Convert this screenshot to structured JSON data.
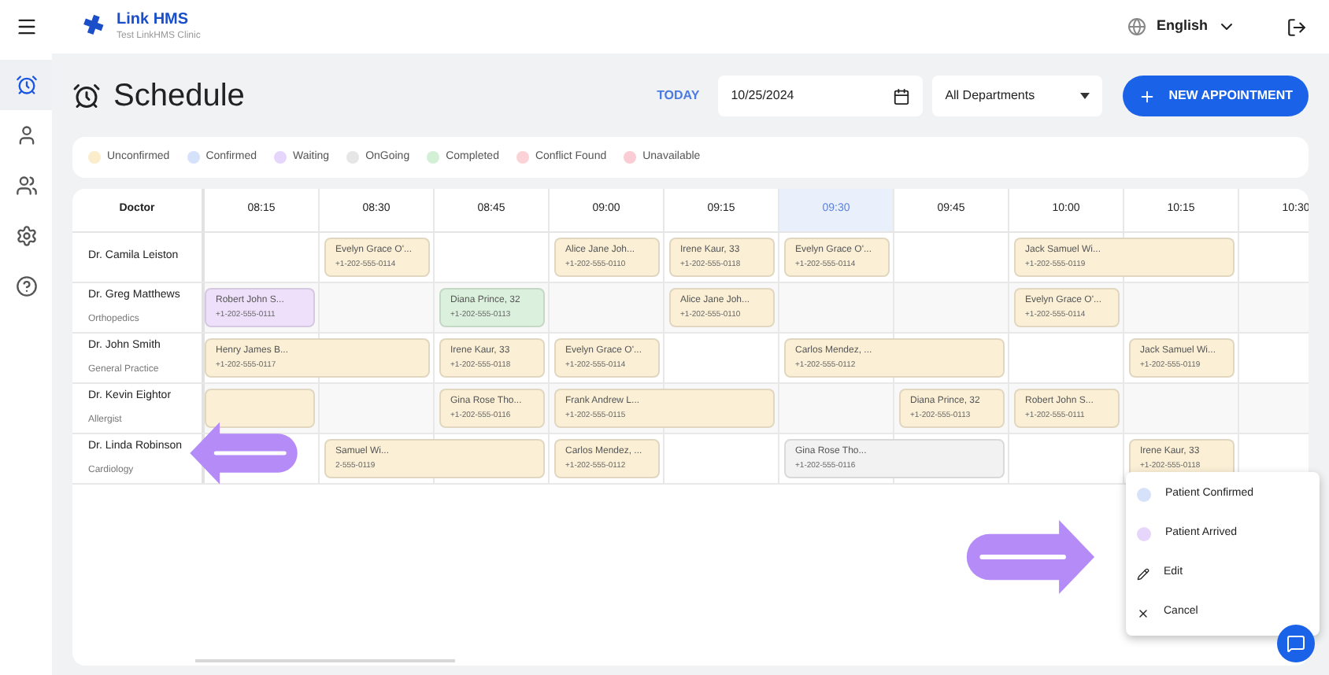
{
  "brand": {
    "name": "Link HMS",
    "subtitle": "Test LinkHMS Clinic"
  },
  "language": "English",
  "sidebar": {
    "items": [
      {
        "selected": true
      },
      {
        "selected": false
      },
      {
        "selected": false
      },
      {
        "selected": false
      },
      {
        "selected": false
      }
    ]
  },
  "page_title": "Schedule",
  "today_button": "TODAY",
  "date_field": "10/25/2024",
  "department_select": "All Departments",
  "new_button": "NEW APPOINTMENT",
  "legend": [
    {
      "label": "Unconfirmed",
      "color": "#fbeccc"
    },
    {
      "label": "Confirmed",
      "color": "#d6e2fa"
    },
    {
      "label": "Waiting",
      "color": "#e6d6fb"
    },
    {
      "label": "OnGoing",
      "color": "#e6e6e6"
    },
    {
      "label": "Completed",
      "color": "#d3efd5"
    },
    {
      "label": "Conflict Found",
      "color": "#fbd3d6"
    },
    {
      "label": "Unavailable",
      "color": "#f9cdd3"
    }
  ],
  "schedule": {
    "doctor_header": "Doctor",
    "times": [
      {
        "label": "08:15",
        "selected": false
      },
      {
        "label": "08:30",
        "selected": false
      },
      {
        "label": "08:45",
        "selected": false
      },
      {
        "label": "09:00",
        "selected": false
      },
      {
        "label": "09:15",
        "selected": false
      },
      {
        "label": "09:30",
        "selected": true
      },
      {
        "label": "09:45",
        "selected": false
      },
      {
        "label": "10:00",
        "selected": false
      },
      {
        "label": "10:15",
        "selected": false
      },
      {
        "label": "10:30",
        "selected": false
      }
    ],
    "rows": [
      {
        "doctor": "Dr. Camila Leiston",
        "cells": [
          {
            "kind": "empty"
          },
          {
            "kind": "appointment",
            "color": "#fbf0d6",
            "name": "Evelyn Grace O'...",
            "phone": "+1-202-555-0114"
          },
          {
            "kind": "empty"
          },
          {
            "kind": "appointment",
            "color": "#fbf0d6",
            "name": "Alice Jane Joh...",
            "phone": "+1-202-555-0110"
          },
          {
            "kind": "appointment",
            "color": "#fbf0d6",
            "name": "Irene Kaur, 33",
            "phone": "+1-202-555-0118"
          },
          {
            "kind": "appointment",
            "color": "#fbf0d6",
            "name": "Evelyn Grace O'...",
            "phone": "+1-202-555-0114"
          },
          {
            "kind": "empty"
          },
          {
            "kind": "appointment",
            "color": "#fbf0d6",
            "name": "Jack Samuel Wi...",
            "phone": "+1-202-555-0119"
          },
          {
            "kind": "continued"
          },
          {
            "kind": "empty"
          }
        ]
      },
      {
        "doctor": "Dr. Greg Matthews",
        "specialty": "Orthopedics",
        "cells": [
          {
            "kind": "appointment",
            "color": "#eee0fb",
            "name": "Robert John S...",
            "phone": "+1-202-555-0111"
          },
          {
            "kind": "empty"
          },
          {
            "kind": "appointment",
            "color": "#dcf1dd",
            "name": "Diana Prince, 32",
            "phone": "+1-202-555-0113"
          },
          {
            "kind": "empty"
          },
          {
            "kind": "appointment",
            "color": "#fbf0d6",
            "name": "Alice Jane Joh...",
            "phone": "+1-202-555-0110"
          },
          {
            "kind": "empty"
          },
          {
            "kind": "empty"
          },
          {
            "kind": "appointment",
            "color": "#fbf0d6",
            "name": "Evelyn Grace O'...",
            "phone": "+1-202-555-0114"
          },
          {
            "kind": "empty"
          },
          {
            "kind": "empty"
          }
        ]
      },
      {
        "doctor": "Dr. John Smith",
        "specialty": "General Practice",
        "cells": [
          {
            "kind": "appointment",
            "color": "#fbf0d6",
            "name": "Henry James B...",
            "phone": "+1-202-555-0117"
          },
          {
            "kind": "continued"
          },
          {
            "kind": "appointment",
            "color": "#fbf0d6",
            "name": "Irene Kaur, 33",
            "phone": "+1-202-555-0118"
          },
          {
            "kind": "appointment",
            "color": "#fbf0d6",
            "name": "Evelyn Grace O'...",
            "phone": "+1-202-555-0114"
          },
          {
            "kind": "empty"
          },
          {
            "kind": "appointment",
            "color": "#fbf0d6",
            "name": "Carlos Mendez, ...",
            "phone": "+1-202-555-0112"
          },
          {
            "kind": "continued"
          },
          {
            "kind": "empty"
          },
          {
            "kind": "appointment",
            "color": "#fbf0d6",
            "name": "Jack Samuel Wi...",
            "phone": "+1-202-555-0119"
          },
          {
            "kind": "empty"
          }
        ]
      },
      {
        "doctor": "Dr. Kevin Eightor",
        "specialty": "Allergist",
        "cells": [
          {
            "kind": "appointment",
            "color": "#fbf0d6"
          },
          {
            "kind": "empty"
          },
          {
            "kind": "appointment",
            "color": "#fbf0d6",
            "name": "Gina Rose Tho...",
            "phone": "+1-202-555-0116"
          },
          {
            "kind": "appointment",
            "color": "#fbf0d6",
            "name": "Frank Andrew L...",
            "phone": "+1-202-555-0115"
          },
          {
            "kind": "continued"
          },
          {
            "kind": "empty"
          },
          {
            "kind": "appointment",
            "color": "#fbf0d6",
            "name": "Diana Prince, 32",
            "phone": "+1-202-555-0113"
          },
          {
            "kind": "appointment",
            "color": "#fbf0d6",
            "name": "Robert John S...",
            "phone": "+1-202-555-0111"
          },
          {
            "kind": "empty"
          },
          {
            "kind": "empty"
          }
        ]
      },
      {
        "doctor": "Dr. Linda Robinson",
        "specialty": "Cardiology",
        "cells": [
          {
            "kind": "empty"
          },
          {
            "kind": "appointment",
            "color": "#fbf0d6",
            "name": "Samuel Wi...",
            "phone": "2-555-0119"
          },
          {
            "kind": "continued"
          },
          {
            "kind": "appointment",
            "color": "#fbf0d6",
            "name": "Carlos Mendez, ...",
            "phone": "+1-202-555-0112"
          },
          {
            "kind": "empty"
          },
          {
            "kind": "appointment",
            "color": "#f2f2f2",
            "name": "Gina Rose Tho...",
            "phone": "+1-202-555-0116"
          },
          {
            "kind": "continued"
          },
          {
            "kind": "empty"
          },
          {
            "kind": "appointment",
            "color": "#fbf0d6",
            "name": "Irene Kaur, 33",
            "phone": "+1-202-555-0118"
          },
          {
            "kind": "empty"
          }
        ]
      }
    ]
  },
  "context_menu": [
    {
      "kind": "dot",
      "label": "Patient Confirmed",
      "color": "#d6e2fa"
    },
    {
      "kind": "dot",
      "label": "Patient Arrived",
      "color": "#e6d6fb"
    },
    {
      "kind": "edit",
      "label": "Edit"
    },
    {
      "kind": "cancel",
      "label": "Cancel"
    }
  ]
}
